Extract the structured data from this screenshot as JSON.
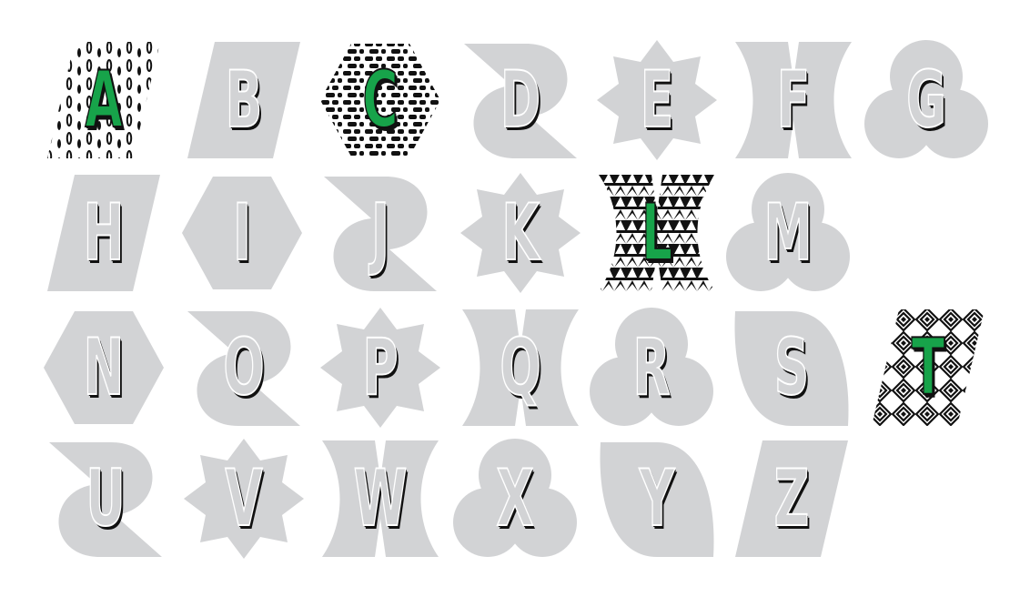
{
  "colors": {
    "tile_gray": "#d2d3d5",
    "revealed_letter": "#17a34a",
    "outline": "#111111",
    "pattern_ink": "#111111",
    "background": "#ffffff"
  },
  "tiles": [
    {
      "letter": "A",
      "shape": "parallelogram",
      "revealed": true,
      "pattern": "drops"
    },
    {
      "letter": "B",
      "shape": "parallelogram",
      "revealed": false
    },
    {
      "letter": "C",
      "shape": "hexagon",
      "revealed": true,
      "pattern": "dashes"
    },
    {
      "letter": "D",
      "shape": "ribbon",
      "revealed": false
    },
    {
      "letter": "E",
      "shape": "star",
      "revealed": false
    },
    {
      "letter": "F",
      "shape": "bowtie",
      "revealed": false
    },
    {
      "letter": "G",
      "shape": "trefoil",
      "revealed": false
    },
    {
      "letter": "H",
      "shape": "parallelogram",
      "revealed": false
    },
    {
      "letter": "I",
      "shape": "hexagon",
      "revealed": false
    },
    {
      "letter": "J",
      "shape": "ribbon",
      "revealed": false
    },
    {
      "letter": "K",
      "shape": "star",
      "revealed": false
    },
    {
      "letter": "L",
      "shape": "bowtie",
      "revealed": true,
      "pattern": "zigzag"
    },
    {
      "letter": "M",
      "shape": "trefoil",
      "revealed": false
    },
    {
      "letter": "N",
      "shape": "hexagon",
      "revealed": false
    },
    {
      "letter": "O",
      "shape": "ribbon",
      "revealed": false
    },
    {
      "letter": "P",
      "shape": "star",
      "revealed": false
    },
    {
      "letter": "Q",
      "shape": "bowtie",
      "revealed": false
    },
    {
      "letter": "R",
      "shape": "trefoil",
      "revealed": false
    },
    {
      "letter": "S",
      "shape": "leaf",
      "revealed": false
    },
    {
      "letter": "T",
      "shape": "parallelogram",
      "revealed": true,
      "pattern": "diamonds"
    },
    {
      "letter": "U",
      "shape": "ribbon",
      "revealed": false
    },
    {
      "letter": "V",
      "shape": "star",
      "revealed": false
    },
    {
      "letter": "W",
      "shape": "bowtie",
      "revealed": false
    },
    {
      "letter": "X",
      "shape": "trefoil",
      "revealed": false
    },
    {
      "letter": "Y",
      "shape": "leaf",
      "revealed": false
    },
    {
      "letter": "Z",
      "shape": "parallelogram",
      "revealed": false
    }
  ]
}
